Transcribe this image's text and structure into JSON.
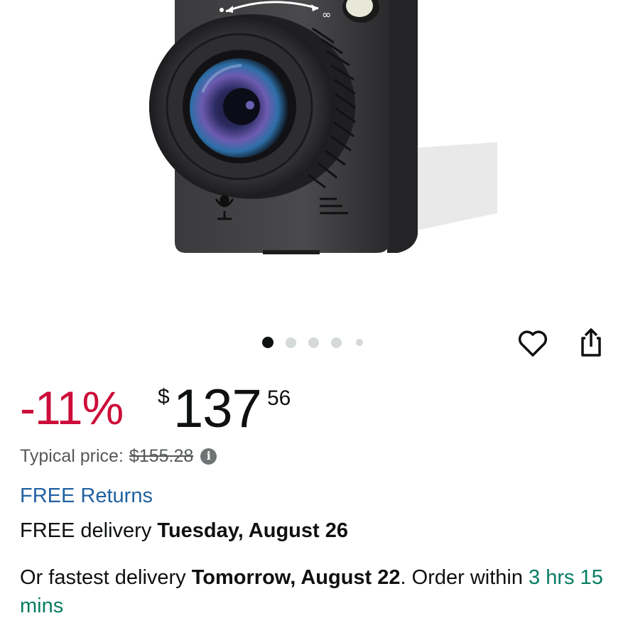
{
  "product": {
    "image_alt": "Dash camera front view with lens",
    "carousel": {
      "total": 5,
      "active": 0
    }
  },
  "actions": {
    "wishlist_icon": "heart-icon",
    "share_icon": "share-icon"
  },
  "price": {
    "discount": "-11%",
    "currency_symbol": "$",
    "whole": "137",
    "fraction": "56",
    "typical_label": "Typical price:",
    "typical_value": "$155.28",
    "info_glyph": "i"
  },
  "returns": {
    "label": "FREE Returns"
  },
  "delivery": {
    "prefix": "FREE delivery ",
    "date": "Tuesday, August 26"
  },
  "fastest": {
    "prefix": "Or fastest delivery ",
    "date": "Tomorrow, August 22",
    "middle": ". Order within ",
    "countdown": "3 hrs 15 mins"
  },
  "colors": {
    "discount": "#cc0c39",
    "link": "#2162a1",
    "countdown": "#067d62"
  }
}
